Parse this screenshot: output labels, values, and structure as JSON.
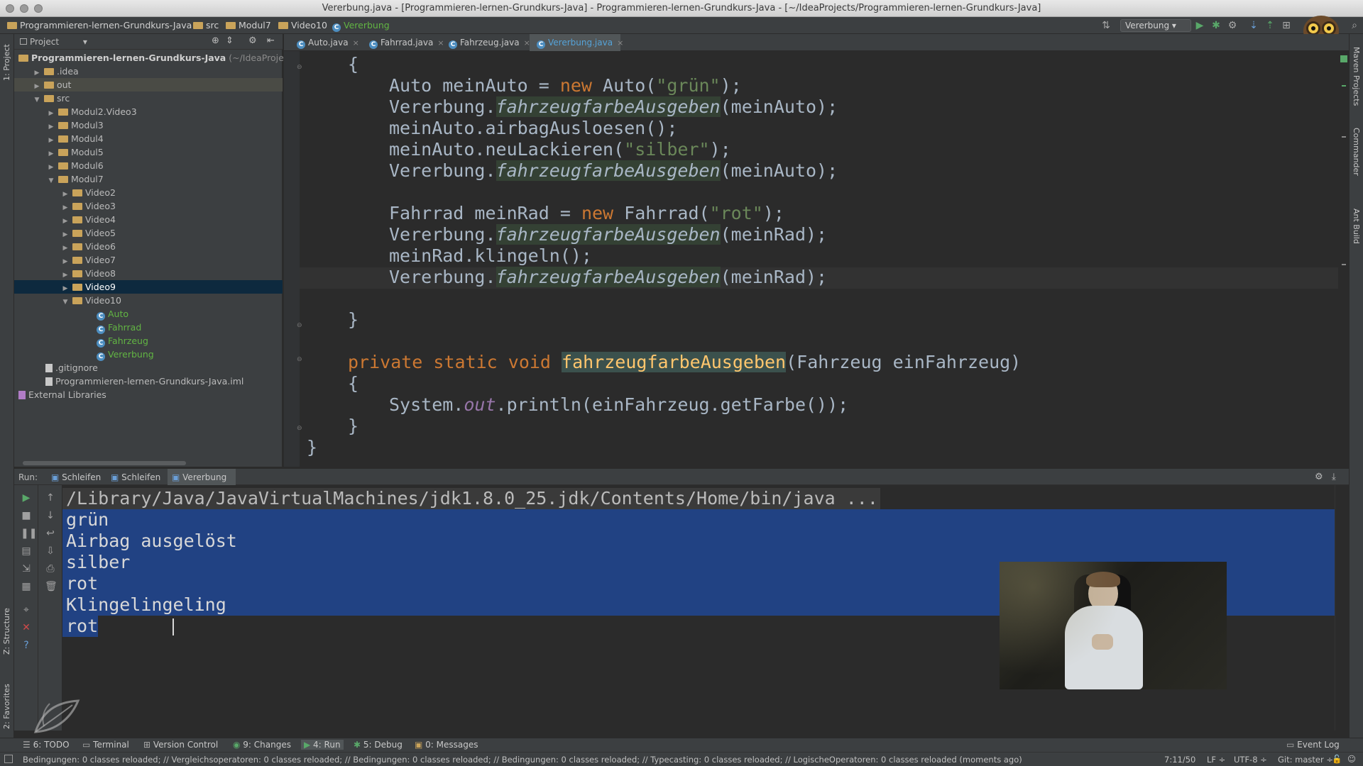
{
  "window": {
    "title": "Vererbung.java - [Programmieren-lernen-Grundkurs-Java] - Programmieren-lernen-Grundkurs-Java - [~/IdeaProjects/Programmieren-lernen-Grundkurs-Java]"
  },
  "breadcrumb": [
    "Programmieren-lernen-Grundkurs-Java",
    "src",
    "Modul7",
    "Video10",
    "Vererbung"
  ],
  "toolbar": {
    "run_config": "Vererbung"
  },
  "left_strip": {
    "project": "1: Project",
    "structure": "Z: Structure",
    "favorites": "2: Favorites"
  },
  "right_strip": {
    "maven": "Maven Projects",
    "commander": "Commander",
    "ant": "Ant Build"
  },
  "project_panel": {
    "header": "Project",
    "root": "Programmieren-lernen-Grundkurs-Java",
    "root_path": "(~/IdeaProjects/Pr",
    "items": [
      {
        "label": ".idea",
        "indent": 1
      },
      {
        "label": "out",
        "indent": 1
      },
      {
        "label": "src",
        "indent": 1
      },
      {
        "label": "Modul2.Video3",
        "indent": 2
      },
      {
        "label": "Modul3",
        "indent": 2
      },
      {
        "label": "Modul4",
        "indent": 2
      },
      {
        "label": "Modul5",
        "indent": 2
      },
      {
        "label": "Modul6",
        "indent": 2
      },
      {
        "label": "Modul7",
        "indent": 2
      },
      {
        "label": "Video2",
        "indent": 3
      },
      {
        "label": "Video3",
        "indent": 3
      },
      {
        "label": "Video4",
        "indent": 3
      },
      {
        "label": "Video5",
        "indent": 3
      },
      {
        "label": "Video6",
        "indent": 3
      },
      {
        "label": "Video7",
        "indent": 3
      },
      {
        "label": "Video8",
        "indent": 3
      },
      {
        "label": "Video9",
        "indent": 3
      },
      {
        "label": "Video10",
        "indent": 3
      },
      {
        "label": "Auto",
        "indent": 4
      },
      {
        "label": "Fahrrad",
        "indent": 4
      },
      {
        "label": "Fahrzeug",
        "indent": 4
      },
      {
        "label": "Vererbung",
        "indent": 4
      },
      {
        "label": ".gitignore",
        "indent": 1
      },
      {
        "label": "Programmieren-lernen-Grundkurs-Java.iml",
        "indent": 1
      },
      {
        "label": "External Libraries",
        "indent": 0
      }
    ]
  },
  "editor_tabs": [
    "Auto.java",
    "Fahrrad.java",
    "Fahrzeug.java",
    "Vererbung.java"
  ],
  "code": {
    "l1": "{",
    "l2a": "Auto meinAuto = ",
    "l2kw": "new",
    "l2b": " Auto(",
    "l2s": "\"grün\"",
    "l2c": ");",
    "l3a": "Vererbung.",
    "l3m": "fahrzeugfarbeAusgeben",
    "l3b": "(meinAuto);",
    "l4": "meinAuto.airbagAusloesen();",
    "l5a": "meinAuto.neuLackieren(",
    "l5s": "\"silber\"",
    "l5b": ");",
    "l6a": "Vererbung.",
    "l6m": "fahrzeugfarbeAusgeben",
    "l6b": "(meinAuto);",
    "l7a": "Fahrrad meinRad = ",
    "l7kw": "new",
    "l7b": " Fahrrad(",
    "l7s": "\"rot\"",
    "l7c": ");",
    "l8a": "Vererbung.",
    "l8m": "fahrzeugfarbeAusgeben",
    "l8b": "(meinRad);",
    "l9": "meinRad.klingeln();",
    "l10a": "Vererbung.",
    "l10m": "fahrzeugfarbeAusgeben",
    "l10b": "(meinRad);",
    "l11": "}",
    "l12kw": "private static void ",
    "l12f": "fahrzeugfarbeAusgeben",
    "l12b": "(Fahrzeug einFahrzeug)",
    "l13": "{",
    "l14a": "System.",
    "l14s": "out",
    "l14b": ".println(einFahrzeug.getFarbe());",
    "l15": "}",
    "l16": "}"
  },
  "run_panel": {
    "label": "Run:",
    "tabs": [
      "Schleifen",
      "Schleifen",
      "Vererbung"
    ],
    "command": "/Library/Java/JavaVirtualMachines/jdk1.8.0_25.jdk/Contents/Home/bin/java ...",
    "output": [
      "grün",
      "Airbag ausgelöst",
      "silber",
      "rot",
      "Klingelingeling",
      "rot"
    ]
  },
  "bottom_tabs": [
    {
      "label": "6: TODO"
    },
    {
      "label": "Terminal"
    },
    {
      "label": "Version Control"
    },
    {
      "label": "9: Changes"
    },
    {
      "label": "4: Run"
    },
    {
      "label": "5: Debug"
    },
    {
      "label": "0: Messages"
    }
  ],
  "event_log": "Event Log",
  "status": {
    "message": "Bedingungen: 0 classes reloaded; // Vergleichsoperatoren: 0 classes reloaded; // Bedingungen: 0 classes reloaded; // Bedingungen: 0 classes reloaded; // Typecasting: 0 classes reloaded; // LogischeOperatoren: 0 classes reloaded (moments ago)",
    "position": "7:11/50",
    "line_sep": "LF ÷",
    "encoding": "UTF-8 ÷",
    "vcs": "Git: master ÷"
  }
}
